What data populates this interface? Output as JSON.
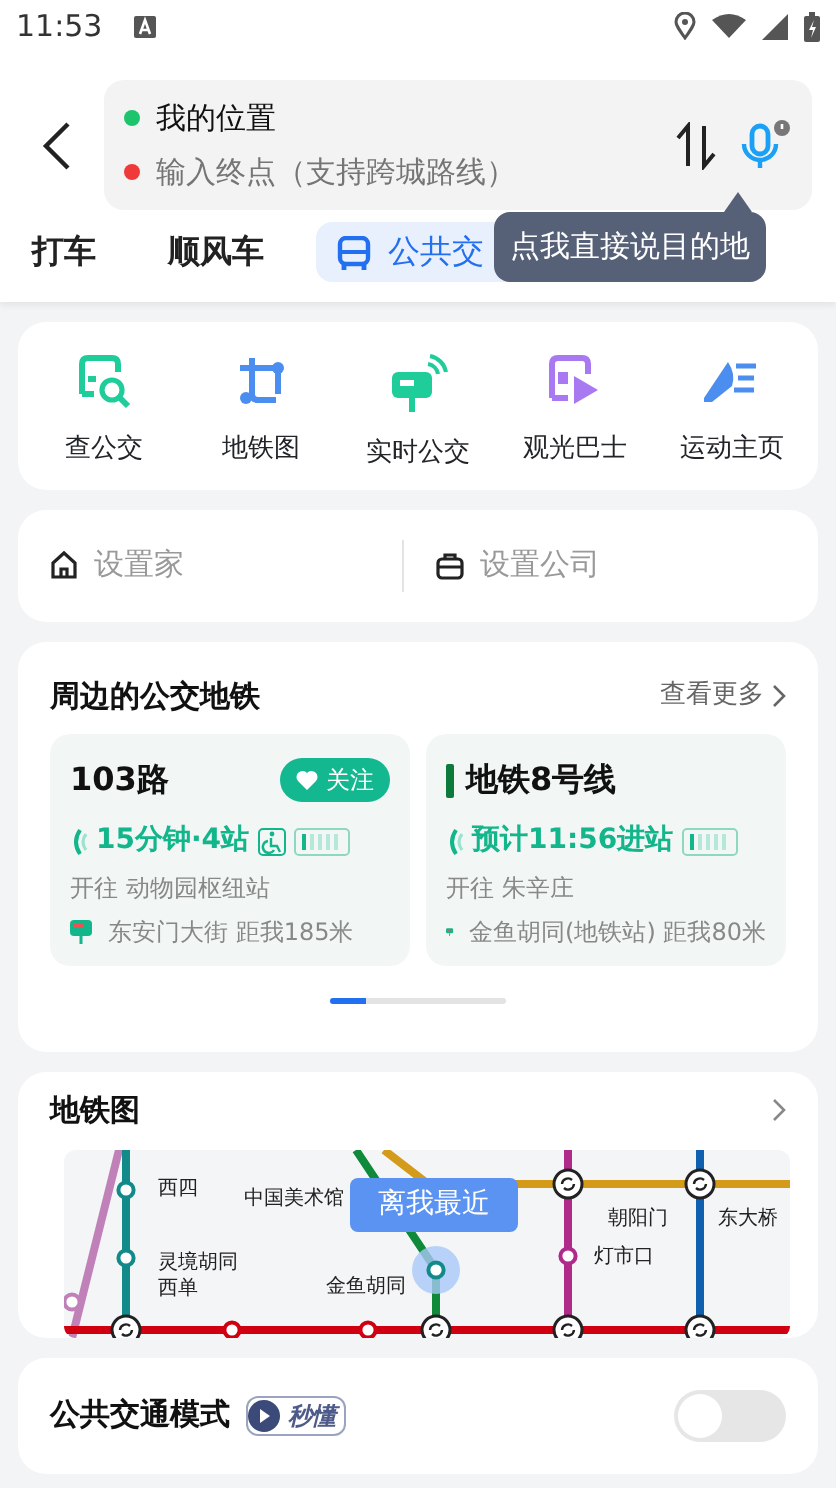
{
  "status_bar": {
    "time": "11:53"
  },
  "route": {
    "origin": "我的位置",
    "destination_placeholder": "输入终点（支持跨城路线）"
  },
  "voice_tip": "点我直接说目的地",
  "tabs": [
    {
      "label": "打车",
      "selected": false
    },
    {
      "label": "顺风车",
      "selected": false
    },
    {
      "label": "公共交",
      "selected": true
    }
  ],
  "shortcuts": [
    "查公交",
    "地铁图",
    "实时公交",
    "观光巴士",
    "运动主页"
  ],
  "places": [
    "设置家",
    "设置公司"
  ],
  "nearby": {
    "title": "周边的公交地铁",
    "more": "查看更多",
    "cards": [
      {
        "kind": "bus",
        "name": "103路",
        "follow": "关注",
        "eta": "15分钟·4站",
        "direction": "开往 动物园枢纽站",
        "stop": "东安门大街 距我185米"
      },
      {
        "kind": "subway",
        "name": "地铁8号线",
        "eta": "预计11:56进站",
        "direction": "开往 朱辛庄",
        "stop": "金鱼胡同(地铁站) 距我80米"
      }
    ]
  },
  "subway_map": {
    "title": "地铁图",
    "nearest_tip": "离我最近",
    "stations": [
      "西四",
      "中国美术馆",
      "灵境胡同",
      "西单",
      "金鱼胡同",
      "朝阳门",
      "灯市口",
      "东大桥"
    ]
  },
  "transit_mode": {
    "title": "公共交通模式",
    "badge": "秒懂",
    "on": false
  }
}
